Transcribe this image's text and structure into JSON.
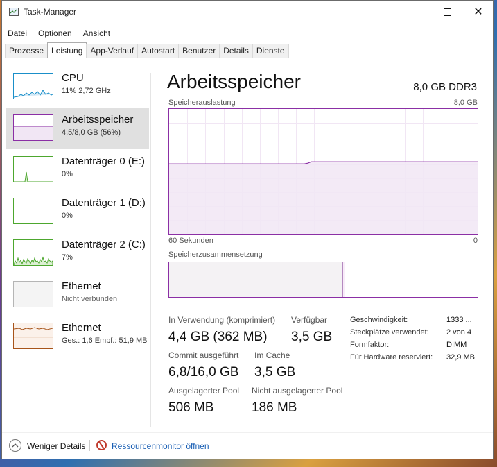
{
  "window": {
    "title": "Task-Manager"
  },
  "menu": [
    "Datei",
    "Optionen",
    "Ansicht"
  ],
  "tabs": [
    "Prozesse",
    "Leistung",
    "App-Verlauf",
    "Autostart",
    "Benutzer",
    "Details",
    "Dienste"
  ],
  "active_tab": "Leistung",
  "sidebar": {
    "items": [
      {
        "title": "CPU",
        "sub": "11% 2,72 GHz",
        "color": "#1a8fc9"
      },
      {
        "title": "Arbeitsspeicher",
        "sub": "4,5/8,0 GB (56%)",
        "color": "#8b2fa5"
      },
      {
        "title": "Datenträger 0 (E:)",
        "sub": "0%",
        "color": "#4da72e"
      },
      {
        "title": "Datenträger 1 (D:)",
        "sub": "0%",
        "color": "#4da72e"
      },
      {
        "title": "Datenträger 2 (C:)",
        "sub": "7%",
        "color": "#4da72e"
      },
      {
        "title": "Ethernet",
        "sub": "Nicht verbunden",
        "color": "#a0a0a0"
      },
      {
        "title": "Ethernet",
        "sub": "Ges.: 1,6 Empf.: 51,9 MB",
        "color": "#a7541a"
      }
    ]
  },
  "main": {
    "title": "Arbeitsspeicher",
    "spec": "8,0 GB DDR3",
    "graph_label": "Speicherauslastung",
    "graph_max": "8,0 GB",
    "time_left": "60 Sekunden",
    "time_right": "0",
    "composition_label": "Speicherzusammensetzung",
    "usage_fraction": 0.56
  },
  "stats": {
    "in_use_label": "In Verwendung (komprimiert)",
    "in_use_value": "4,4 GB (362 MB)",
    "available_label": "Verfügbar",
    "available_value": "3,5 GB",
    "commit_label": "Commit ausgeführt",
    "commit_value": "6,8/16,0 GB",
    "cache_label": "Im Cache",
    "cache_value": "3,5 GB",
    "paged_label": "Ausgelagerter Pool",
    "paged_value": "506 MB",
    "nonpaged_label": "Nicht ausgelagerter Pool",
    "nonpaged_value": "186 MB"
  },
  "info": [
    {
      "label": "Geschwindigkeit:",
      "value": "1333 ..."
    },
    {
      "label": "Steckplätze verwendet:",
      "value": "2 von 4"
    },
    {
      "label": "Formfaktor:",
      "value": "DIMM"
    },
    {
      "label": "Für Hardware reserviert:",
      "value": "32,9 MB"
    }
  ],
  "footer": {
    "fewer_details_first": "W",
    "fewer_details_rest": "eniger Details",
    "resource_monitor": "Ressourcenmonitor öffnen"
  }
}
